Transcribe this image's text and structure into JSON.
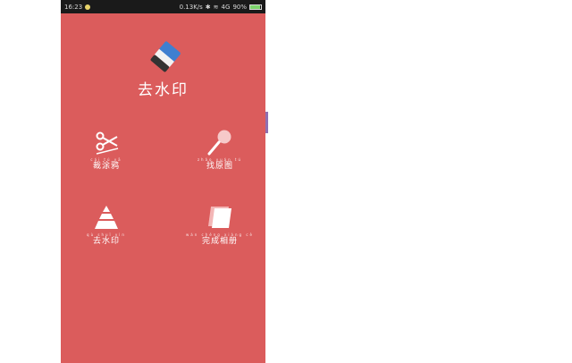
{
  "status_bar": {
    "time": "16:23",
    "speed": "0.13K/s",
    "network": "4G",
    "battery": "90%",
    "battery_level": 0.9
  },
  "app": {
    "title": "去水印",
    "logo_icon": "eraser-icon"
  },
  "tiles": [
    {
      "label": "裁涂鸦",
      "pinyin": "cái tú yā",
      "icon": "scissors-icon"
    },
    {
      "label": "找原图",
      "pinyin": "zhǎo yuán tú",
      "icon": "magnifier-icon"
    },
    {
      "label": "去水印",
      "pinyin": "qù shuǐ yìn",
      "icon": "triangle-stack-icon"
    },
    {
      "label": "完成相册",
      "pinyin": "wán chéng xiàng cè",
      "icon": "photo-album-icon"
    }
  ],
  "colors": {
    "background": "#db5c5c",
    "statusbar": "#1a1a1a",
    "logo_blue": "#3f7fd0",
    "logo_dark": "#333333"
  }
}
